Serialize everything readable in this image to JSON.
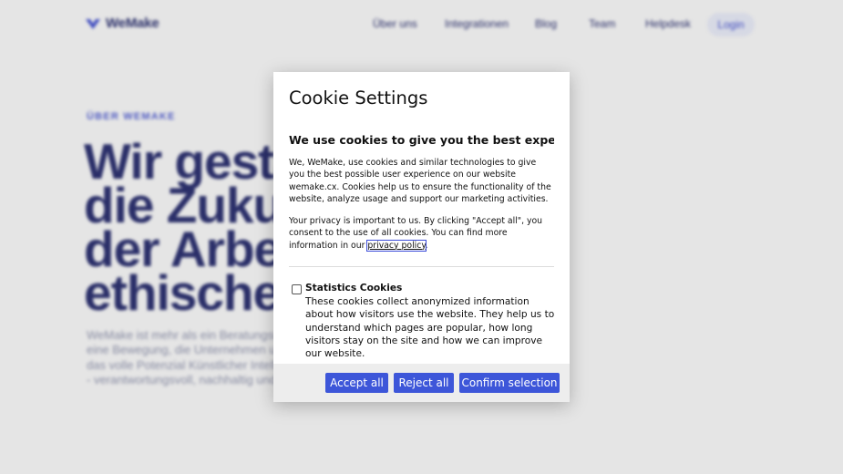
{
  "header": {
    "brand": "WeMake",
    "nav": [
      {
        "label": "Über uns"
      },
      {
        "label": "Integrationen"
      },
      {
        "label": "Blog"
      },
      {
        "label": "Team"
      },
      {
        "label": "Helpdesk"
      }
    ],
    "login_label": "Login"
  },
  "hero": {
    "eyebrow": "ÜBER WEMAKE",
    "title_lines": [
      "Wir gestal",
      "die Zukun",
      "der Arbeit",
      "ethischer"
    ],
    "paragraph_lines": [
      "WeMake ist mehr als ein Beratungsunter",
      "eine Bewegung, die Unternehmen und M",
      "das volle Potenzial Künstlicher Intelligen",
      "- verantwortungsvoll, nachhaltig und zuk"
    ]
  },
  "cookie_modal": {
    "title": "Cookie Settings",
    "subtitle": "We use cookies to give you the best experience.",
    "intro": "We,     WeMake, use cookies and similar technologies to give you the best possible user experience on our website wemake.cx. Cookies help us to ensure the functionality of the website, analyze usage and support our marketing activities.",
    "privacy_text": "Your privacy is important to us. By clicking \"Accept all\", you consent to the use of all cookies. You can find more information in our ",
    "privacy_link": "privacy policy",
    "privacy_end": ".",
    "statistics": {
      "title": "Statistics Cookies",
      "description": "These cookies collect anonymized information about how visitors use the website. They help us to understand which pages are popular, how long visitors stay on the site and how we can improve our website.",
      "checked": false
    },
    "buttons": {
      "accept": "Accept all",
      "reject": "Reject all",
      "confirm": "Confirm selection"
    }
  },
  "colors": {
    "brand_navy": "#1f2466",
    "accent_blue": "#3d56d9"
  }
}
